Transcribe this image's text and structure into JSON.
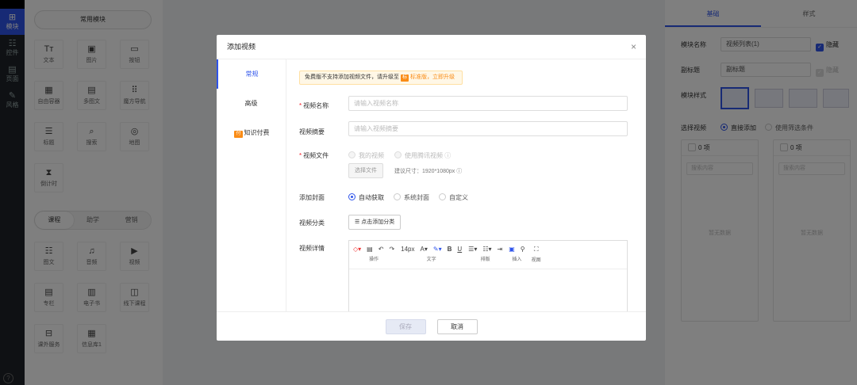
{
  "left_nav": {
    "items": [
      {
        "label": "模块",
        "icon": "plus-square-icon",
        "active": true
      },
      {
        "label": "控件",
        "icon": "sliders-icon"
      },
      {
        "label": "页面",
        "icon": "pages-icon"
      },
      {
        "label": "风格",
        "icon": "brush-icon"
      }
    ],
    "help": "?"
  },
  "components": {
    "common_label": "常用模块",
    "common": [
      {
        "label": "文本",
        "glyph": "Tт",
        "icon": "text-icon"
      },
      {
        "label": "图片",
        "glyph": "▣",
        "icon": "image-icon"
      },
      {
        "label": "按钮",
        "glyph": "▭",
        "icon": "button-icon"
      },
      {
        "label": "自由容器",
        "glyph": "▦",
        "icon": "container-icon"
      },
      {
        "label": "多图文",
        "glyph": "▤",
        "icon": "multi-image-text-icon"
      },
      {
        "label": "魔方导航",
        "glyph": "⠿",
        "icon": "cube-nav-icon"
      },
      {
        "label": "标题",
        "glyph": "☰",
        "icon": "heading-icon"
      },
      {
        "label": "搜索",
        "glyph": "⌕",
        "icon": "search-icon"
      },
      {
        "label": "地图",
        "glyph": "◎",
        "icon": "map-pin-icon"
      },
      {
        "label": "倒计时",
        "glyph": "⧗",
        "icon": "hourglass-icon"
      }
    ],
    "tabs": [
      "课程",
      "助学",
      "营销"
    ],
    "course": [
      {
        "label": "图文",
        "glyph": "☷",
        "icon": "article-icon"
      },
      {
        "label": "音频",
        "glyph": "♫",
        "icon": "audio-icon"
      },
      {
        "label": "视频",
        "glyph": "▶",
        "icon": "video-icon"
      },
      {
        "label": "专栏",
        "glyph": "▤",
        "icon": "column-icon"
      },
      {
        "label": "电子书",
        "glyph": "▥",
        "icon": "ebook-icon"
      },
      {
        "label": "线下课程",
        "glyph": "◫",
        "icon": "offline-course-icon"
      },
      {
        "label": "课外服务",
        "glyph": "⊟",
        "icon": "service-icon"
      },
      {
        "label": "信息库1",
        "glyph": "▦",
        "icon": "info-library-icon"
      }
    ]
  },
  "right_panel": {
    "tabs": [
      "基础",
      "样式"
    ],
    "name_label": "模块名称",
    "name_value": "视频列表(1)",
    "hide_label": "隐藏",
    "subtitle_label": "副标题",
    "subtitle_value": "副标题",
    "style_label": "模块样式",
    "select_label": "选择视频",
    "opt_direct": "直接添加",
    "opt_filter": "使用筛选条件",
    "count": "0 项",
    "search_placeholder": "搜索内容",
    "empty": "暂无数据",
    "accent": "#2f54eb"
  },
  "modal": {
    "title": "添加视频",
    "close": "×",
    "side_tabs": [
      "常规",
      "高级",
      "知识付费"
    ],
    "paid_badge": "付",
    "notice_pre": "免费版不支持添加视频文件，请升级至",
    "notice_tag": "标",
    "notice_link": "标准版，立即升级",
    "fields": {
      "name_label": "视频名称",
      "name_placeholder": "请输入视频名称",
      "summary_label": "视频摘要",
      "summary_placeholder": "请输入视频摘要",
      "file_label": "视频文件",
      "file_opt1": "我的视频",
      "file_opt2": "使用腾讯视频",
      "choose_file": "选择文件",
      "size_hint": "建议尺寸：1920*1080px",
      "cover_label": "添加封面",
      "cover_opts": [
        "自动获取",
        "系统封面",
        "自定义"
      ],
      "category_label": "视频分类",
      "category_btn": "点击添加分类",
      "detail_label": "视频详情"
    },
    "editor": {
      "font_size": "14px",
      "groups": [
        "操作",
        "文字",
        "排版",
        "插入",
        "视图"
      ]
    },
    "save": "保存",
    "cancel": "取消"
  }
}
